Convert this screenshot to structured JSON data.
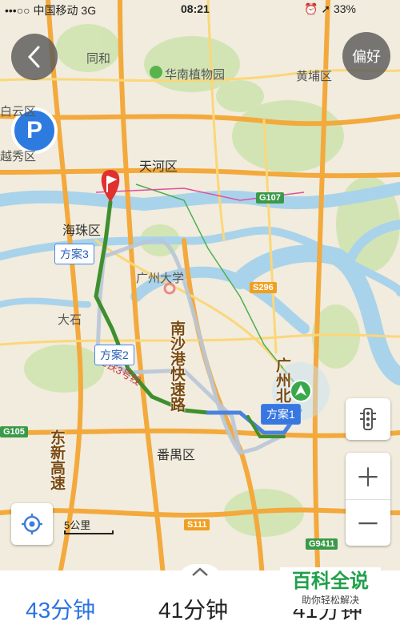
{
  "status_bar": {
    "carrier": "•••○○ 中国移动",
    "network": "3G",
    "time": "08:21",
    "battery": "33%"
  },
  "buttons": {
    "back_icon": "chevron-left-icon",
    "preferences_label": "偏好",
    "parking_label": "P"
  },
  "map_labels": {
    "tonghe": "同和",
    "botanical_garden": "华南植物园",
    "huangpu": "黄埔区",
    "baiyun": "白云区",
    "yuexiu": "越秀区",
    "tianhe": "天河区",
    "haizhu": "海珠区",
    "university_town": "广州大学",
    "dashi": "大石",
    "panyu": "番禺区",
    "south_sha_expressway": "南沙港快速路",
    "metro_line3": "地铁3号线",
    "dongxin_expressway": "东新高速",
    "guangzhou_north": "广州北"
  },
  "road_badges": {
    "g107": "G107",
    "s296": "S296",
    "s111": "S111",
    "g9411": "G9411",
    "g105": "G105"
  },
  "route_plans": {
    "plan1": "方案1",
    "plan2": "方案2",
    "plan3": "方案3"
  },
  "scale_label": "5公里",
  "route_options": [
    {
      "duration": "43分钟"
    },
    {
      "duration": "41分钟"
    },
    {
      "duration": "41分钟"
    }
  ],
  "watermark": {
    "title": "百科全说",
    "subtitle": "助你轻松解决"
  },
  "colors": {
    "accent": "#2a73e0",
    "route_main": "#3e8f2e",
    "watermark_green": "#1fa04a"
  }
}
